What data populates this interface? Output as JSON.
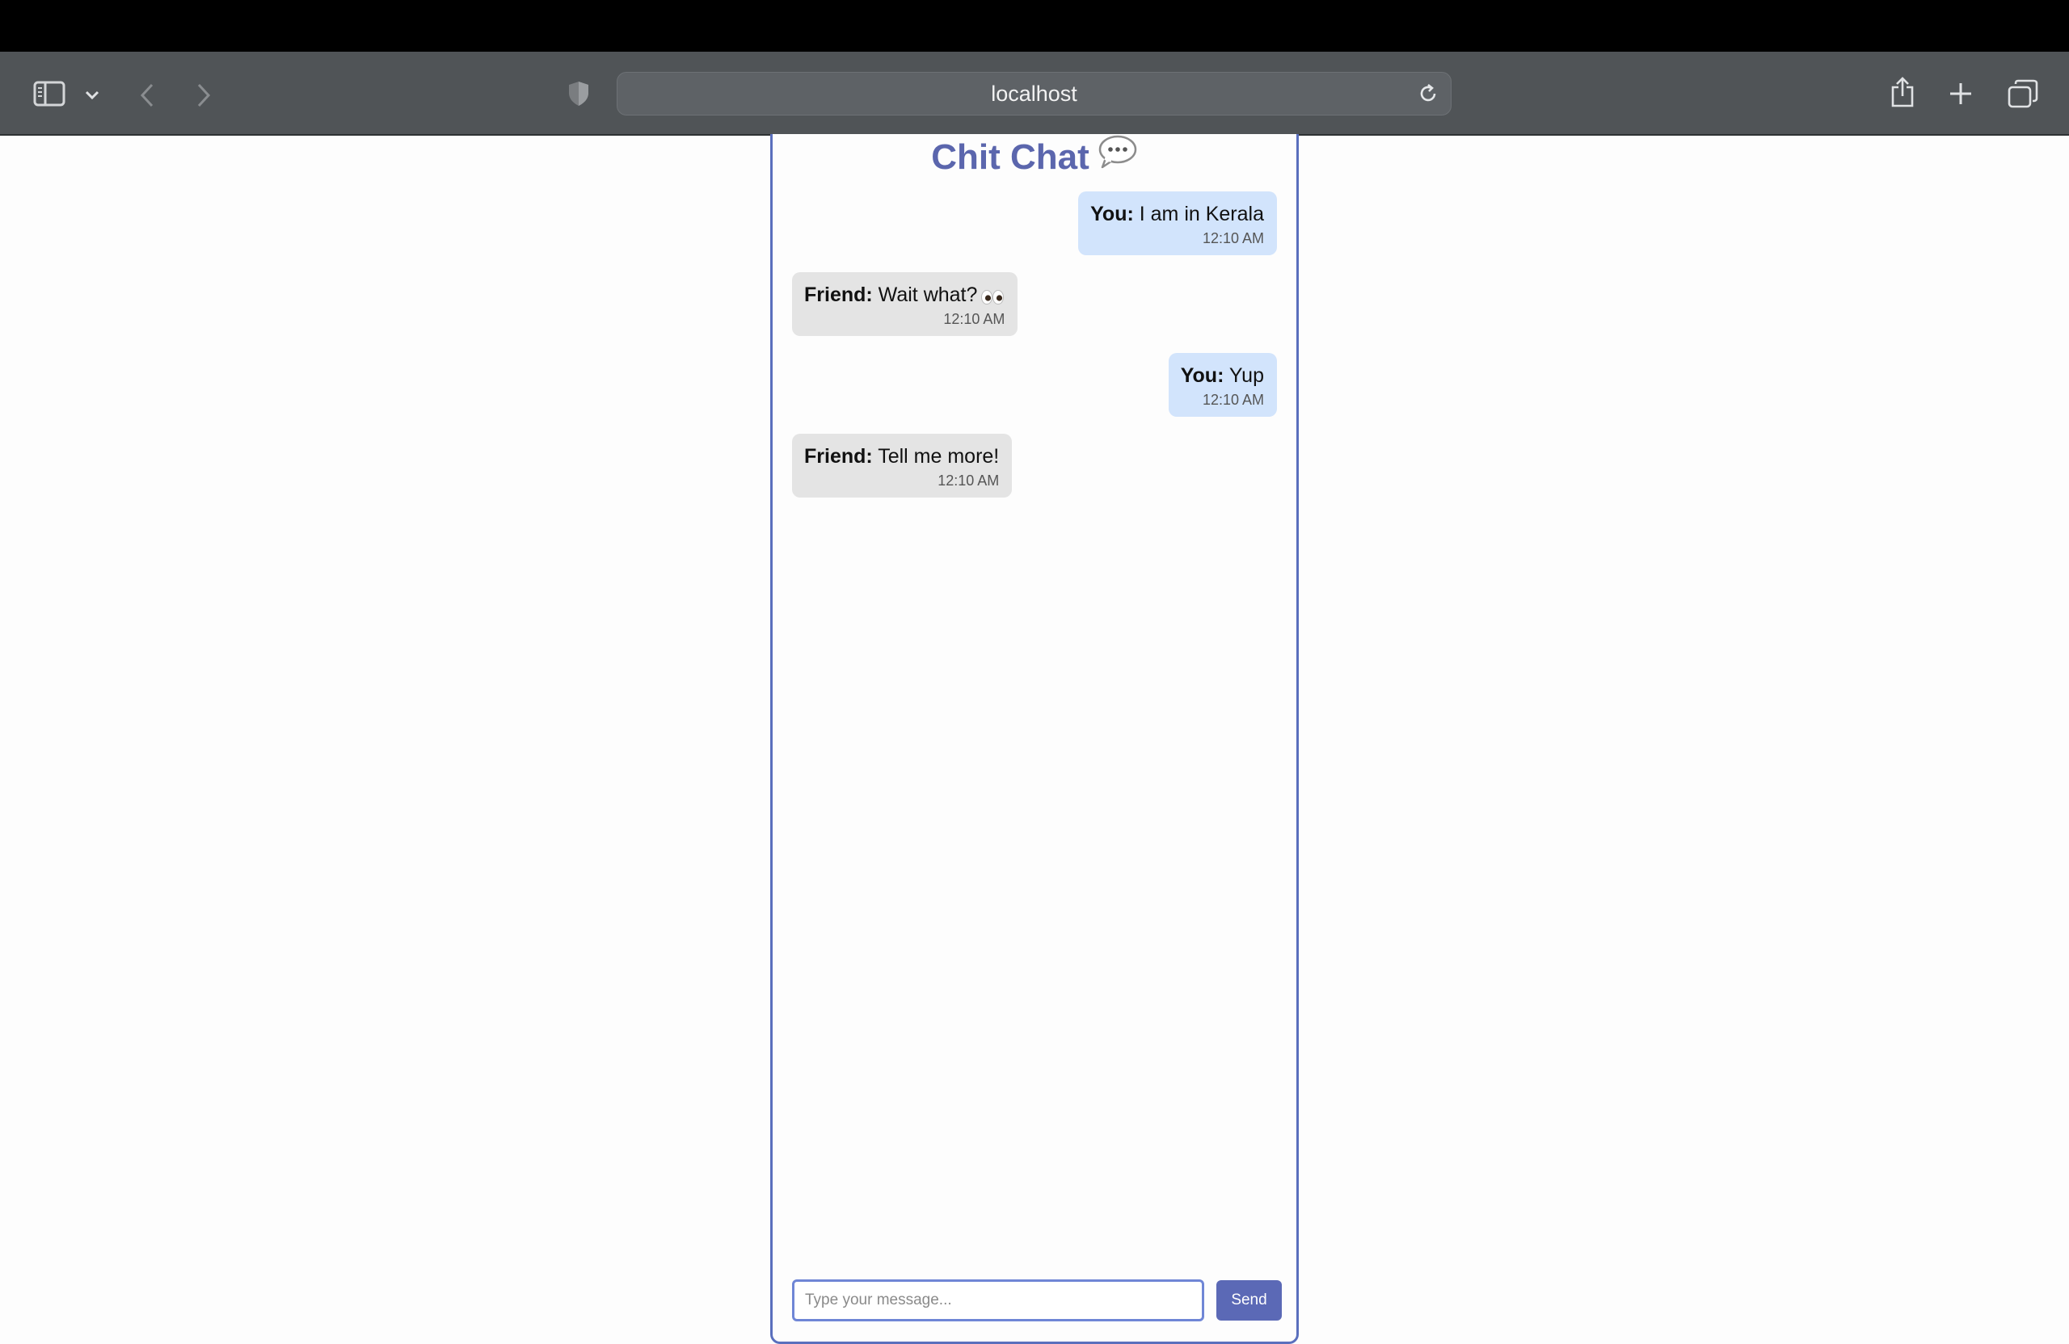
{
  "browser": {
    "address": "localhost"
  },
  "chat": {
    "title": "Chit Chat",
    "title_icon": "speech-bubble-icon",
    "messages": [
      {
        "from": "you",
        "sender": "You:",
        "text": "I am in Kerala",
        "time": "12:10 AM"
      },
      {
        "from": "friend",
        "sender": "Friend:",
        "text": "Wait what?",
        "emoji": "eyes-icon",
        "time": "12:10 AM"
      },
      {
        "from": "you",
        "sender": "You:",
        "text": "Yup",
        "time": "12:10 AM"
      },
      {
        "from": "friend",
        "sender": "Friend:",
        "text": "Tell me more!",
        "time": "12:10 AM"
      }
    ],
    "input": {
      "value": "",
      "placeholder": "Type your message..."
    },
    "send_label": "Send"
  },
  "colors": {
    "accent": "#5b66ad",
    "you_bubble": "#d2e4fc",
    "friend_bubble": "#e4e4e4",
    "toolbar": "#505457"
  }
}
